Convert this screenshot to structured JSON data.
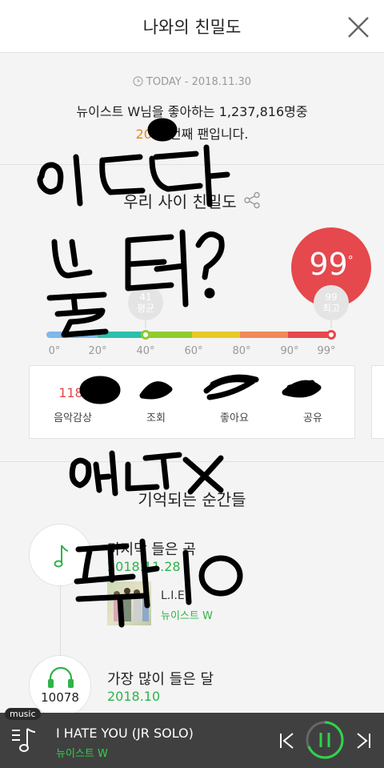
{
  "header": {
    "title": "나와의 친밀도",
    "close_icon": "close-icon"
  },
  "today": {
    "label": "TODAY - 2018.11.30"
  },
  "fan_rank": {
    "line1": "뉴이스트 W님을 좋아하는 1,237,816명중",
    "rank_prefix": "20",
    "rank_suffix": "번째 팬입니다."
  },
  "intimacy": {
    "title": "우리 사이 친밀도",
    "score": "99",
    "degree_symbol": "°",
    "average_marker": {
      "value": "41",
      "label": "평균"
    },
    "max_marker": {
      "value": "99",
      "label": "최고"
    },
    "ticks": [
      "0°",
      "20°",
      "40°",
      "60°",
      "80°",
      "90°",
      "99°"
    ],
    "bar_colors": [
      "#7fb8ea",
      "#2bbfae",
      "#8fcb2e",
      "#e8c92a",
      "#f08a59",
      "#e5484d"
    ],
    "average_level": 41,
    "my_level": 99
  },
  "stats": [
    {
      "value": "118,",
      "label": "음악감상"
    },
    {
      "value": "",
      "label": "조회"
    },
    {
      "value": "",
      "label": "좋아요"
    },
    {
      "value": "",
      "label": "공유"
    }
  ],
  "moments": {
    "title": "기억되는 순간들",
    "last_song": {
      "title": "마지막 들은 곡",
      "date": "2018.11.28",
      "song": "L.I.E",
      "artist": "뉴이스트 W"
    },
    "most_month": {
      "title": "가장 많이 들은 달",
      "date": "2018.10",
      "count": "10078"
    }
  },
  "player": {
    "tag": "music",
    "title": "I HATE YOU (JR SOLO)",
    "artist": "뉴이스트 W"
  },
  "colors": {
    "accent_green": "#2fb34a",
    "score_red": "#e5484d",
    "rank_orange": "#e08a1e"
  }
}
